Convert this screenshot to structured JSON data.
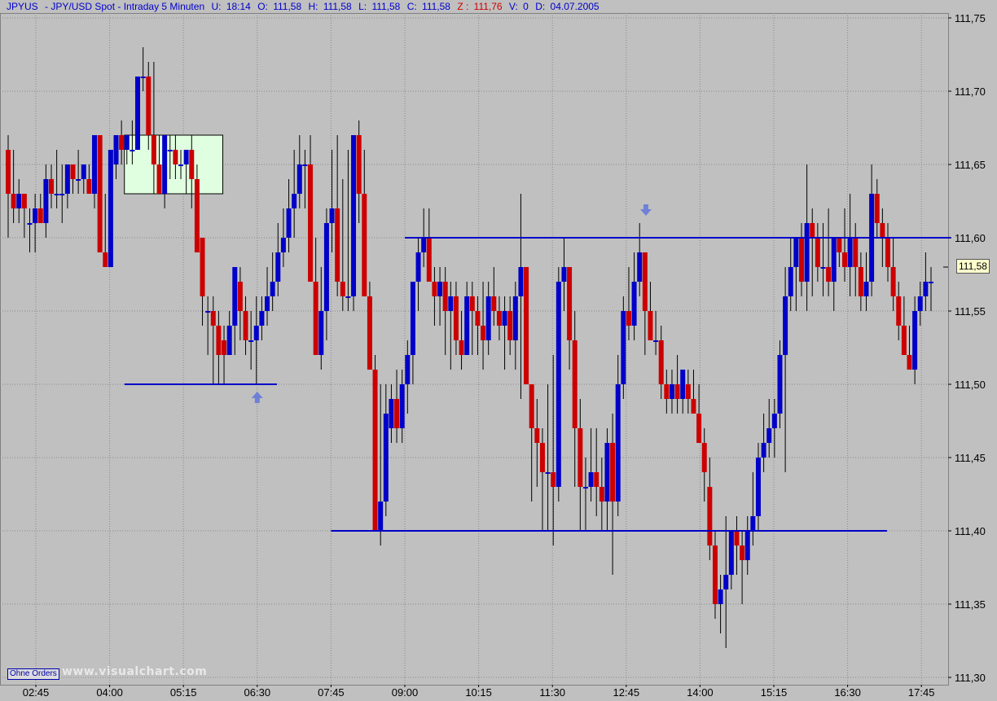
{
  "info": {
    "symbol": "JPYUS",
    "description": "- JPY/USD Spot - Intraday 5 Minuten",
    "u_label": "U:",
    "u_value": "18:14",
    "o_label": "O:",
    "o_value": "111,58",
    "h_label": "H:",
    "h_value": "111,58",
    "l_label": "L:",
    "l_value": "111,58",
    "c_label": "C:",
    "c_value": "111,58",
    "z_label": "Z :",
    "z_value": "111,76",
    "v_label": "V:",
    "v_value": "0",
    "d_label": "D:",
    "d_value": "04.07.2005"
  },
  "footer": {
    "ohne_orders": "Ohne Orders",
    "watermark": "www.visualchart.com"
  },
  "current_price_label": "111,58",
  "colors": {
    "background": "#c0c0c0",
    "bull": "#0000c8",
    "bear": "#cc0000",
    "line": "#0000c8",
    "arrow": "#6f80d8",
    "box": "#e0ffe0"
  },
  "chart_data": {
    "type": "candlestick",
    "title": "JPYUS - JPY/USD Spot - Intraday 5 Minuten",
    "ylim": [
      111.3,
      111.75
    ],
    "y_ticks": [
      "111,75",
      "111,70",
      "111,65",
      "111,60",
      "111,55",
      "111,50",
      "111,45",
      "111,40",
      "111,35",
      "111,30"
    ],
    "x_ticks": [
      "02:45",
      "04:00",
      "05:15",
      "06:30",
      "07:45",
      "09:00",
      "10:15",
      "11:30",
      "12:45",
      "14:00",
      "15:15",
      "16:30",
      "17:45"
    ],
    "grid": true,
    "horizontal_lines": [
      {
        "from": "04:15",
        "to": "06:50",
        "y": 111.5
      },
      {
        "from": "07:45",
        "to": "17:10",
        "y": 111.4
      },
      {
        "from": "09:00",
        "to": "18:15",
        "y": 111.6
      }
    ],
    "box": {
      "from": "04:15",
      "to": "05:55",
      "y_top": 111.67,
      "y_bottom": 111.63
    },
    "arrows": [
      {
        "x": "06:30",
        "y": 111.495,
        "dir": "up"
      },
      {
        "x": "13:05",
        "y": 111.615,
        "dir": "down"
      }
    ],
    "candles": [
      [
        111.66,
        111.67,
        111.6,
        111.63
      ],
      [
        111.63,
        111.66,
        111.61,
        111.62
      ],
      [
        111.62,
        111.64,
        111.61,
        111.63
      ],
      [
        111.63,
        111.63,
        111.6,
        111.62
      ],
      [
        111.61,
        111.62,
        111.59,
        111.61
      ],
      [
        111.61,
        111.63,
        111.59,
        111.62
      ],
      [
        111.62,
        111.63,
        111.61,
        111.61
      ],
      [
        111.61,
        111.65,
        111.6,
        111.64
      ],
      [
        111.64,
        111.65,
        111.62,
        111.63
      ],
      [
        111.63,
        111.66,
        111.62,
        111.63
      ],
      [
        111.63,
        111.65,
        111.61,
        111.63
      ],
      [
        111.63,
        111.65,
        111.62,
        111.65
      ],
      [
        111.65,
        111.65,
        111.63,
        111.64
      ],
      [
        111.64,
        111.66,
        111.63,
        111.64
      ],
      [
        111.64,
        111.65,
        111.63,
        111.65
      ],
      [
        111.64,
        111.65,
        111.63,
        111.63
      ],
      [
        111.63,
        111.67,
        111.62,
        111.67
      ],
      [
        111.67,
        111.67,
        111.59,
        111.59
      ],
      [
        111.59,
        111.63,
        111.58,
        111.58
      ],
      [
        111.58,
        111.66,
        111.58,
        111.66
      ],
      [
        111.65,
        111.67,
        111.64,
        111.67
      ],
      [
        111.67,
        111.68,
        111.65,
        111.66
      ],
      [
        111.66,
        111.67,
        111.65,
        111.67
      ],
      [
        111.66,
        111.68,
        111.65,
        111.66
      ],
      [
        111.66,
        111.71,
        111.66,
        111.71
      ],
      [
        111.71,
        111.73,
        111.7,
        111.71
      ],
      [
        111.71,
        111.72,
        111.66,
        111.67
      ],
      [
        111.67,
        111.72,
        111.63,
        111.65
      ],
      [
        111.65,
        111.67,
        111.63,
        111.63
      ],
      [
        111.63,
        111.66,
        111.62,
        111.67
      ],
      [
        111.66,
        111.67,
        111.64,
        111.66
      ],
      [
        111.66,
        111.67,
        111.64,
        111.65
      ],
      [
        111.65,
        111.66,
        111.64,
        111.65
      ],
      [
        111.65,
        111.66,
        111.63,
        111.66
      ],
      [
        111.66,
        111.67,
        111.62,
        111.64
      ],
      [
        111.64,
        111.65,
        111.59,
        111.59
      ],
      [
        111.6,
        111.6,
        111.54,
        111.56
      ],
      [
        111.55,
        111.56,
        111.52,
        111.55
      ],
      [
        111.55,
        111.56,
        111.5,
        111.54
      ],
      [
        111.54,
        111.55,
        111.5,
        111.52
      ],
      [
        111.53,
        111.54,
        111.5,
        111.52
      ],
      [
        111.52,
        111.55,
        111.52,
        111.54
      ],
      [
        111.54,
        111.58,
        111.52,
        111.58
      ],
      [
        111.57,
        111.58,
        111.53,
        111.55
      ],
      [
        111.55,
        111.56,
        111.52,
        111.53
      ],
      [
        111.53,
        111.55,
        111.51,
        111.53
      ],
      [
        111.53,
        111.56,
        111.5,
        111.54
      ],
      [
        111.54,
        111.56,
        111.53,
        111.55
      ],
      [
        111.55,
        111.58,
        111.54,
        111.56
      ],
      [
        111.56,
        111.59,
        111.55,
        111.57
      ],
      [
        111.57,
        111.61,
        111.56,
        111.59
      ],
      [
        111.59,
        111.62,
        111.58,
        111.6
      ],
      [
        111.6,
        111.64,
        111.59,
        111.62
      ],
      [
        111.62,
        111.66,
        111.6,
        111.63
      ],
      [
        111.63,
        111.67,
        111.62,
        111.65
      ],
      [
        111.65,
        111.66,
        111.62,
        111.65
      ],
      [
        111.65,
        111.67,
        111.57,
        111.57
      ],
      [
        111.57,
        111.6,
        111.52,
        111.52
      ],
      [
        111.52,
        111.58,
        111.51,
        111.55
      ],
      [
        111.55,
        111.62,
        111.53,
        111.61
      ],
      [
        111.61,
        111.66,
        111.59,
        111.62
      ],
      [
        111.62,
        111.67,
        111.56,
        111.57
      ],
      [
        111.57,
        111.64,
        111.55,
        111.56
      ],
      [
        111.56,
        111.66,
        111.55,
        111.56
      ],
      [
        111.56,
        111.67,
        111.55,
        111.67
      ],
      [
        111.67,
        111.68,
        111.61,
        111.63
      ],
      [
        111.63,
        111.66,
        111.56,
        111.56
      ],
      [
        111.56,
        111.57,
        111.51,
        111.51
      ],
      [
        111.51,
        111.52,
        111.4,
        111.4
      ],
      [
        111.4,
        111.5,
        111.39,
        111.42
      ],
      [
        111.42,
        111.5,
        111.41,
        111.48
      ],
      [
        111.47,
        111.5,
        111.46,
        111.49
      ],
      [
        111.49,
        111.51,
        111.46,
        111.47
      ],
      [
        111.47,
        111.51,
        111.46,
        111.5
      ],
      [
        111.5,
        111.53,
        111.48,
        111.52
      ],
      [
        111.52,
        111.56,
        111.5,
        111.57
      ],
      [
        111.57,
        111.6,
        111.55,
        111.59
      ],
      [
        111.59,
        111.62,
        111.58,
        111.6
      ],
      [
        111.6,
        111.62,
        111.57,
        111.57
      ],
      [
        111.57,
        111.58,
        111.54,
        111.56
      ],
      [
        111.56,
        111.58,
        111.54,
        111.57
      ],
      [
        111.57,
        111.58,
        111.52,
        111.55
      ],
      [
        111.55,
        111.57,
        111.51,
        111.56
      ],
      [
        111.56,
        111.57,
        111.52,
        111.53
      ],
      [
        111.53,
        111.55,
        111.51,
        111.52
      ],
      [
        111.52,
        111.57,
        111.52,
        111.56
      ],
      [
        111.56,
        111.57,
        111.52,
        111.55
      ],
      [
        111.55,
        111.56,
        111.52,
        111.54
      ],
      [
        111.54,
        111.57,
        111.51,
        111.53
      ],
      [
        111.53,
        111.57,
        111.52,
        111.56
      ],
      [
        111.56,
        111.58,
        111.54,
        111.55
      ],
      [
        111.55,
        111.56,
        111.53,
        111.54
      ],
      [
        111.54,
        111.56,
        111.51,
        111.55
      ],
      [
        111.55,
        111.56,
        111.52,
        111.53
      ],
      [
        111.53,
        111.57,
        111.51,
        111.56
      ],
      [
        111.56,
        111.63,
        111.49,
        111.58
      ],
      [
        111.58,
        111.58,
        111.5,
        111.5
      ],
      [
        111.5,
        111.5,
        111.42,
        111.47
      ],
      [
        111.47,
        111.49,
        111.43,
        111.46
      ],
      [
        111.46,
        111.47,
        111.4,
        111.44
      ],
      [
        111.44,
        111.5,
        111.4,
        111.44
      ],
      [
        111.44,
        111.52,
        111.39,
        111.43
      ],
      [
        111.43,
        111.58,
        111.42,
        111.57
      ],
      [
        111.57,
        111.6,
        111.55,
        111.58
      ],
      [
        111.58,
        111.58,
        111.51,
        111.53
      ],
      [
        111.53,
        111.55,
        111.43,
        111.47
      ],
      [
        111.47,
        111.49,
        111.4,
        111.43
      ],
      [
        111.43,
        111.45,
        111.4,
        111.43
      ],
      [
        111.43,
        111.47,
        111.42,
        111.44
      ],
      [
        111.44,
        111.47,
        111.41,
        111.43
      ],
      [
        111.43,
        111.45,
        111.4,
        111.42
      ],
      [
        111.42,
        111.47,
        111.4,
        111.46
      ],
      [
        111.46,
        111.48,
        111.37,
        111.42
      ],
      [
        111.42,
        111.52,
        111.41,
        111.5
      ],
      [
        111.5,
        111.56,
        111.49,
        111.55
      ],
      [
        111.55,
        111.58,
        111.53,
        111.54
      ],
      [
        111.54,
        111.59,
        111.53,
        111.57
      ],
      [
        111.57,
        111.61,
        111.56,
        111.59
      ],
      [
        111.59,
        111.59,
        111.52,
        111.55
      ],
      [
        111.55,
        111.57,
        111.53,
        111.53
      ],
      [
        111.53,
        111.55,
        111.52,
        111.53
      ],
      [
        111.53,
        111.54,
        111.49,
        111.5
      ],
      [
        111.5,
        111.51,
        111.48,
        111.49
      ],
      [
        111.49,
        111.51,
        111.48,
        111.5
      ],
      [
        111.5,
        111.52,
        111.48,
        111.49
      ],
      [
        111.49,
        111.51,
        111.48,
        111.51
      ],
      [
        111.5,
        111.51,
        111.48,
        111.49
      ],
      [
        111.49,
        111.51,
        111.48,
        111.48
      ],
      [
        111.48,
        111.5,
        111.47,
        111.46
      ],
      [
        111.46,
        111.47,
        111.42,
        111.44
      ],
      [
        111.43,
        111.45,
        111.38,
        111.39
      ],
      [
        111.39,
        111.4,
        111.34,
        111.35
      ],
      [
        111.35,
        111.37,
        111.33,
        111.36
      ],
      [
        111.36,
        111.41,
        111.32,
        111.37
      ],
      [
        111.37,
        111.4,
        111.36,
        111.4
      ],
      [
        111.4,
        111.41,
        111.37,
        111.39
      ],
      [
        111.39,
        111.4,
        111.35,
        111.38
      ],
      [
        111.38,
        111.41,
        111.37,
        111.4
      ],
      [
        111.4,
        111.44,
        111.39,
        111.41
      ],
      [
        111.41,
        111.46,
        111.4,
        111.45
      ],
      [
        111.45,
        111.48,
        111.44,
        111.46
      ],
      [
        111.46,
        111.49,
        111.45,
        111.47
      ],
      [
        111.47,
        111.49,
        111.45,
        111.48
      ],
      [
        111.48,
        111.53,
        111.47,
        111.52
      ],
      [
        111.52,
        111.58,
        111.44,
        111.56
      ],
      [
        111.56,
        111.6,
        111.55,
        111.58
      ],
      [
        111.58,
        111.59,
        111.55,
        111.6
      ],
      [
        111.6,
        111.61,
        111.56,
        111.57
      ],
      [
        111.57,
        111.65,
        111.55,
        111.61
      ],
      [
        111.61,
        111.62,
        111.56,
        111.6
      ],
      [
        111.6,
        111.61,
        111.57,
        111.58
      ],
      [
        111.58,
        111.61,
        111.56,
        111.58
      ],
      [
        111.58,
        111.62,
        111.56,
        111.57
      ],
      [
        111.57,
        111.6,
        111.55,
        111.6
      ],
      [
        111.6,
        111.6,
        111.58,
        111.59
      ],
      [
        111.59,
        111.62,
        111.57,
        111.58
      ],
      [
        111.58,
        111.63,
        111.56,
        111.6
      ],
      [
        111.6,
        111.61,
        111.56,
        111.58
      ],
      [
        111.58,
        111.59,
        111.55,
        111.56
      ],
      [
        111.56,
        111.59,
        111.55,
        111.57
      ],
      [
        111.57,
        111.65,
        111.56,
        111.63
      ],
      [
        111.63,
        111.64,
        111.6,
        111.61
      ],
      [
        111.61,
        111.62,
        111.58,
        111.6
      ],
      [
        111.6,
        111.61,
        111.57,
        111.58
      ],
      [
        111.58,
        111.6,
        111.55,
        111.56
      ],
      [
        111.56,
        111.57,
        111.53,
        111.54
      ],
      [
        111.54,
        111.56,
        111.52,
        111.52
      ],
      [
        111.52,
        111.54,
        111.51,
        111.51
      ],
      [
        111.51,
        111.56,
        111.5,
        111.55
      ],
      [
        111.55,
        111.57,
        111.54,
        111.56
      ],
      [
        111.56,
        111.59,
        111.55,
        111.57
      ],
      [
        111.57,
        111.58,
        111.55,
        111.57
      ]
    ]
  }
}
